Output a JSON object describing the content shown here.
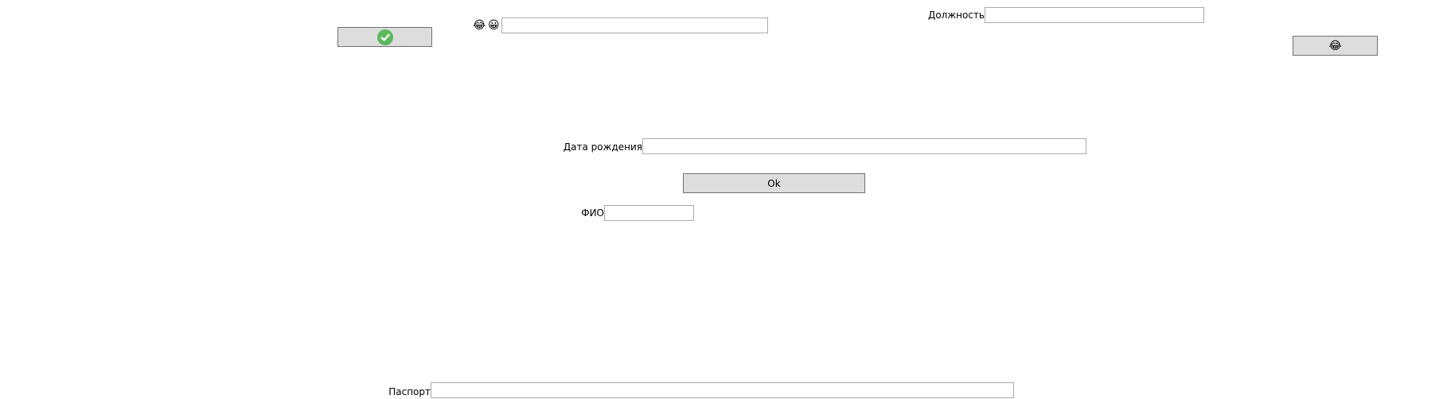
{
  "form": {
    "position_label": "Должность",
    "position_value": "",
    "birthdate_label": "Дата рождения",
    "birthdate_value": "",
    "fullname_label": "ФИО",
    "fullname_value": "",
    "passport_label": "Паспорт",
    "passport_value": "",
    "emoji_field_value": ""
  },
  "buttons": {
    "ok_label": "Ok",
    "check_icon": "check-circle-icon",
    "smile_icon": "smile-icon"
  },
  "emoji_labels": {
    "first": "😂",
    "second": "😀"
  },
  "colors": {
    "button_bg": "#dddddd",
    "check_green": "#5cb85c"
  }
}
